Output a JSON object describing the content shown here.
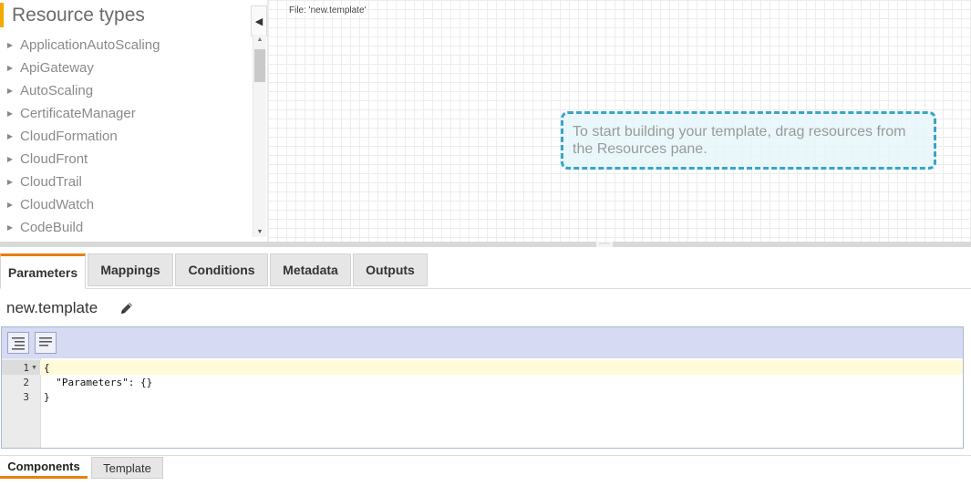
{
  "resource_panel": {
    "title": "Resource types",
    "items": [
      {
        "label": "ApplicationAutoScaling"
      },
      {
        "label": "ApiGateway"
      },
      {
        "label": "AutoScaling"
      },
      {
        "label": "CertificateManager"
      },
      {
        "label": "CloudFormation"
      },
      {
        "label": "CloudFront"
      },
      {
        "label": "CloudTrail"
      },
      {
        "label": "CloudWatch"
      },
      {
        "label": "CodeBuild"
      }
    ]
  },
  "canvas": {
    "file_label": "File: 'new.template'",
    "hint": "To start building your template, drag resources from the Resources pane."
  },
  "tabs": [
    {
      "label": "Parameters",
      "active": true
    },
    {
      "label": "Mappings",
      "active": false
    },
    {
      "label": "Conditions",
      "active": false
    },
    {
      "label": "Metadata",
      "active": false
    },
    {
      "label": "Outputs",
      "active": false
    }
  ],
  "template_name": "new.template",
  "editor": {
    "lines": [
      {
        "num": "1",
        "text": "{"
      },
      {
        "num": "2",
        "text": "  \"Parameters\": {}"
      },
      {
        "num": "3",
        "text": "}"
      }
    ]
  },
  "bottom_tabs": [
    {
      "label": "Components",
      "active": true
    },
    {
      "label": "Template",
      "active": false
    }
  ],
  "colors": {
    "accent_orange": "#e8800f",
    "header_bar": "#f2a900",
    "hint_border": "#3aa3c9",
    "toolbar_bg": "#d6daf3"
  },
  "icons": [
    "collapse-left-icon",
    "pencil-icon",
    "format-json-icon",
    "remove-whitespace-icon",
    "expand-triangle-icon"
  ]
}
